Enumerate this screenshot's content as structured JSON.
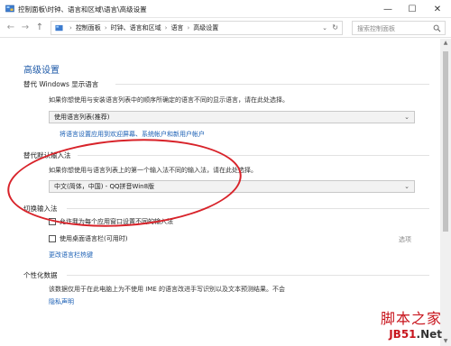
{
  "window": {
    "title": "控制面板\\时钟、语言和区域\\语言\\高级设置",
    "minimize": "—",
    "maximize": "☐",
    "close": "✕"
  },
  "nav": {
    "back": "←",
    "forward": "→",
    "up": "↑",
    "breadcrumbs": [
      "控制面板",
      "时钟、语言和区域",
      "语言",
      "高级设置"
    ],
    "search_placeholder": "搜索控制面板"
  },
  "page": {
    "title": "高级设置",
    "display_language": {
      "heading": "替代 Windows 显示语言",
      "description": "如果你想使用与安装语言列表中的顺序所确定的语言不同的显示语言，请在此处选择。",
      "selected": "使用语言列表(推荐)",
      "link": "将语言设置应用到欢迎屏幕、系统帐户和新用户帐户"
    },
    "input_method": {
      "heading": "替代默认输入法",
      "description": "如果你想使用与语言列表上的第一个输入法不同的输入法，请在此处选择。",
      "selected": "中文(简体，中国) - QQ拼音Win8版"
    },
    "switch_input": {
      "heading": "切换输入法",
      "option1": "允许我为每个应用窗口设置不同的输入法",
      "option2": "使用桌面语言栏(可用时)",
      "options_link": "选项",
      "hotkey_link": "更改语言栏热键"
    },
    "personalization": {
      "heading": "个性化数据",
      "description": "该数据仅用于在此电脑上为不使用 IME 的语言改进手写识别以及文本预测结果。不会",
      "privacy_link": "隐私声明"
    }
  },
  "watermark": {
    "line1": "脚本之家",
    "line2a": "JB51",
    "line2b": ".Net"
  },
  "colors": {
    "accent": "#1e5aa8",
    "link": "#1a5fb4",
    "annotation": "#d8232a",
    "watermark": "#c8151d"
  }
}
